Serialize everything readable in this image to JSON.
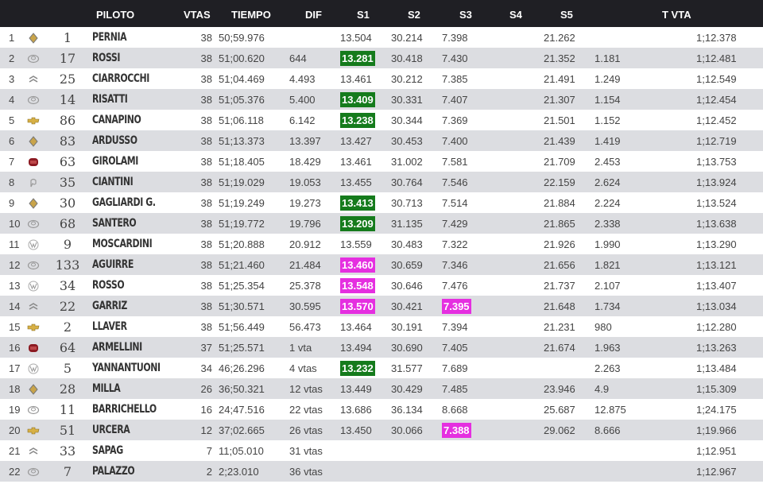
{
  "colors": {
    "header_bg": "#1f1f24",
    "row_alt": "#dcdde1",
    "best_green": "#157b1c",
    "best_magenta": "#e52fe0",
    "action": "#d9312f"
  },
  "header": {
    "piloto": "PILOTO",
    "vtas": "VTAS",
    "tiempo": "TIEMPO",
    "dif": "DIF",
    "s1": "S1",
    "s2": "S2",
    "s3": "S3",
    "s4": "S4",
    "s5": "S5",
    "tvta": "T VTA"
  },
  "rows": [
    {
      "pos": "1",
      "brand": "brand-logo-renault",
      "num": "1",
      "name": "PERNIA",
      "vtas": "38",
      "tiempo": "50;59.976",
      "dif": "",
      "s1": "13.504",
      "s1_hl": "",
      "s2": "30.214",
      "s3": "7.398",
      "s3_hl": "",
      "s4": "",
      "s5": "21.262",
      "gap": "",
      "tvta": "1;12.378"
    },
    {
      "pos": "2",
      "brand": "brand-logo-toyota",
      "num": "17",
      "name": "ROSSI",
      "vtas": "38",
      "tiempo": "51;00.620",
      "dif": "644",
      "s1": "13.281",
      "s1_hl": "green",
      "s2": "30.418",
      "s3": "7.430",
      "s3_hl": "",
      "s4": "",
      "s5": "21.352",
      "gap": "1.181",
      "tvta": "1;12.481"
    },
    {
      "pos": "3",
      "brand": "brand-logo-citroen",
      "num": "25",
      "name": "CIARROCCHI",
      "vtas": "38",
      "tiempo": "51;04.469",
      "dif": "4.493",
      "s1": "13.461",
      "s1_hl": "",
      "s2": "30.212",
      "s3": "7.385",
      "s3_hl": "",
      "s4": "",
      "s5": "21.491",
      "gap": "1.249",
      "tvta": "1;12.549"
    },
    {
      "pos": "4",
      "brand": "brand-logo-toyota",
      "num": "14",
      "name": "RISATTI",
      "vtas": "38",
      "tiempo": "51;05.376",
      "dif": "5.400",
      "s1": "13.409",
      "s1_hl": "green",
      "s2": "30.331",
      "s3": "7.407",
      "s3_hl": "",
      "s4": "",
      "s5": "21.307",
      "gap": "1.154",
      "tvta": "1;12.454"
    },
    {
      "pos": "5",
      "brand": "brand-logo-chevrolet",
      "num": "86",
      "name": "CANAPINO",
      "vtas": "38",
      "tiempo": "51;06.118",
      "dif": "6.142",
      "s1": "13.238",
      "s1_hl": "green",
      "s2": "30.344",
      "s3": "7.369",
      "s3_hl": "",
      "s4": "",
      "s5": "21.501",
      "gap": "1.152",
      "tvta": "1;12.452"
    },
    {
      "pos": "6",
      "brand": "brand-logo-renault",
      "num": "83",
      "name": "ARDUSSO",
      "vtas": "38",
      "tiempo": "51;13.373",
      "dif": "13.397",
      "s1": "13.427",
      "s1_hl": "",
      "s2": "30.453",
      "s3": "7.400",
      "s3_hl": "",
      "s4": "",
      "s5": "21.439",
      "gap": "1.419",
      "tvta": "1;12.719"
    },
    {
      "pos": "7",
      "brand": "brand-logo-fiat",
      "num": "63",
      "name": "GIROLAMI",
      "vtas": "38",
      "tiempo": "51;18.405",
      "dif": "18.429",
      "s1": "13.461",
      "s1_hl": "",
      "s2": "31.002",
      "s3": "7.581",
      "s3_hl": "",
      "s4": "",
      "s5": "21.709",
      "gap": "2.453",
      "tvta": "1;13.753"
    },
    {
      "pos": "8",
      "brand": "brand-logo-peugeot",
      "num": "35",
      "name": "CIANTINI",
      "vtas": "38",
      "tiempo": "51;19.029",
      "dif": "19.053",
      "s1": "13.455",
      "s1_hl": "",
      "s2": "30.764",
      "s3": "7.546",
      "s3_hl": "",
      "s4": "",
      "s5": "22.159",
      "gap": "2.624",
      "tvta": "1;13.924"
    },
    {
      "pos": "9",
      "brand": "brand-logo-renault",
      "num": "30",
      "name": "GAGLIARDI G.",
      "vtas": "38",
      "tiempo": "51;19.249",
      "dif": "19.273",
      "s1": "13.413",
      "s1_hl": "green",
      "s2": "30.713",
      "s3": "7.514",
      "s3_hl": "",
      "s4": "",
      "s5": "21.884",
      "gap": "2.224",
      "tvta": "1;13.524"
    },
    {
      "pos": "10",
      "brand": "brand-logo-toyota",
      "num": "68",
      "name": "SANTERO",
      "vtas": "38",
      "tiempo": "51;19.772",
      "dif": "19.796",
      "s1": "13.209",
      "s1_hl": "green",
      "s2": "31.135",
      "s3": "7.429",
      "s3_hl": "",
      "s4": "",
      "s5": "21.865",
      "gap": "2.338",
      "tvta": "1;13.638"
    },
    {
      "pos": "11",
      "brand": "brand-logo-volkswagen",
      "num": "9",
      "name": "MOSCARDINI",
      "vtas": "38",
      "tiempo": "51;20.888",
      "dif": "20.912",
      "s1": "13.559",
      "s1_hl": "",
      "s2": "30.483",
      "s3": "7.322",
      "s3_hl": "",
      "s4": "",
      "s5": "21.926",
      "gap": "1.990",
      "tvta": "1;13.290"
    },
    {
      "pos": "12",
      "brand": "brand-logo-toyota",
      "num": "133",
      "name": "AGUIRRE",
      "vtas": "38",
      "tiempo": "51;21.460",
      "dif": "21.484",
      "s1": "13.460",
      "s1_hl": "magenta",
      "s2": "30.659",
      "s3": "7.346",
      "s3_hl": "",
      "s4": "",
      "s5": "21.656",
      "gap": "1.821",
      "tvta": "1;13.121"
    },
    {
      "pos": "13",
      "brand": "brand-logo-volkswagen",
      "num": "34",
      "name": "ROSSO",
      "vtas": "38",
      "tiempo": "51;25.354",
      "dif": "25.378",
      "s1": "13.548",
      "s1_hl": "magenta",
      "s2": "30.646",
      "s3": "7.476",
      "s3_hl": "",
      "s4": "",
      "s5": "21.737",
      "gap": "2.107",
      "tvta": "1;13.407"
    },
    {
      "pos": "14",
      "brand": "brand-logo-citroen",
      "num": "22",
      "name": "GARRIZ",
      "vtas": "38",
      "tiempo": "51;30.571",
      "dif": "30.595",
      "s1": "13.570",
      "s1_hl": "magenta",
      "s2": "30.421",
      "s3": "7.395",
      "s3_hl": "magenta",
      "s4": "",
      "s5": "21.648",
      "gap": "1.734",
      "tvta": "1;13.034"
    },
    {
      "pos": "15",
      "brand": "brand-logo-chevrolet",
      "num": "2",
      "name": "LLAVER",
      "vtas": "38",
      "tiempo": "51;56.449",
      "dif": "56.473",
      "s1": "13.464",
      "s1_hl": "",
      "s2": "30.191",
      "s3": "7.394",
      "s3_hl": "",
      "s4": "",
      "s5": "21.231",
      "gap": "980",
      "tvta": "1;12.280"
    },
    {
      "pos": "16",
      "brand": "brand-logo-fiat",
      "num": "64",
      "name": "ARMELLINI",
      "vtas": "37",
      "tiempo": "51;25.571",
      "dif": "1 vta",
      "s1": "13.494",
      "s1_hl": "",
      "s2": "30.690",
      "s3": "7.405",
      "s3_hl": "",
      "s4": "",
      "s5": "21.674",
      "gap": "1.963",
      "tvta": "1;13.263"
    },
    {
      "pos": "17",
      "brand": "brand-logo-volkswagen",
      "num": "5",
      "name": "YANNANTUONI",
      "vtas": "34",
      "tiempo": "46;26.296",
      "dif": "4 vtas",
      "s1": "13.232",
      "s1_hl": "green",
      "s2": "31.577",
      "s3": "7.689",
      "s3_hl": "",
      "s4": "",
      "s5": "",
      "gap": "2.263",
      "tvta": "1;13.484"
    },
    {
      "pos": "18",
      "brand": "brand-logo-renault",
      "num": "28",
      "name": "MILLA",
      "vtas": "26",
      "tiempo": "36;50.321",
      "dif": "12 vtas",
      "s1": "13.449",
      "s1_hl": "",
      "s2": "30.429",
      "s3": "7.485",
      "s3_hl": "",
      "s4": "",
      "s5": "23.946",
      "gap": "4.9",
      "tvta": "1;15.309"
    },
    {
      "pos": "19",
      "brand": "brand-logo-toyota",
      "num": "11",
      "name": "BARRICHELLO",
      "vtas": "16",
      "tiempo": "24;47.516",
      "dif": "22 vtas",
      "s1": "13.686",
      "s1_hl": "",
      "s2": "36.134",
      "s3": "8.668",
      "s3_hl": "",
      "s4": "",
      "s5": "25.687",
      "gap": "12.875",
      "tvta": "1;24.175"
    },
    {
      "pos": "20",
      "brand": "brand-logo-chevrolet",
      "num": "51",
      "name": "URCERA",
      "vtas": "12",
      "tiempo": "37;02.665",
      "dif": "26 vtas",
      "s1": "13.450",
      "s1_hl": "",
      "s2": "30.066",
      "s3": "7.388",
      "s3_hl": "magenta",
      "s4": "",
      "s5": "29.062",
      "gap": "8.666",
      "tvta": "1;19.966"
    },
    {
      "pos": "21",
      "brand": "brand-logo-citroen",
      "num": "33",
      "name": "SAPAG",
      "vtas": "7",
      "tiempo": "11;05.010",
      "dif": "31 vtas",
      "s1": "",
      "s1_hl": "",
      "s2": "",
      "s3": "",
      "s3_hl": "",
      "s4": "",
      "s5": "",
      "gap": "",
      "tvta": "1;12.951"
    },
    {
      "pos": "22",
      "brand": "brand-logo-toyota",
      "num": "7",
      "name": "PALAZZO",
      "vtas": "2",
      "tiempo": "2;23.010",
      "dif": "36 vtas",
      "s1": "",
      "s1_hl": "",
      "s2": "",
      "s3": "",
      "s3_hl": "",
      "s4": "",
      "s5": "",
      "gap": "",
      "tvta": "1;12.967"
    }
  ]
}
